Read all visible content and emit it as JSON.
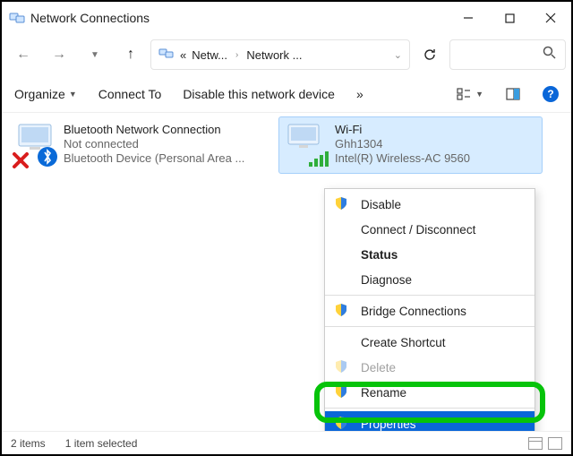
{
  "window": {
    "title": "Network Connections"
  },
  "breadcrumb": {
    "prefix": "«",
    "a": "Netw...",
    "b": "Network ..."
  },
  "toolbar": {
    "organize": "Organize",
    "connect": "Connect To",
    "disable": "Disable this network device",
    "overflow": "»"
  },
  "adapters": {
    "bt": {
      "name": "Bluetooth Network Connection",
      "status": "Not connected",
      "device": "Bluetooth Device (Personal Area ..."
    },
    "wifi": {
      "name": "Wi-Fi",
      "ssid": "Ghh1304",
      "device": "Intel(R) Wireless-AC 9560"
    }
  },
  "context_menu": {
    "disable": "Disable",
    "connect": "Connect / Disconnect",
    "status": "Status",
    "diagnose": "Diagnose",
    "bridge": "Bridge Connections",
    "shortcut": "Create Shortcut",
    "delete": "Delete",
    "rename": "Rename",
    "properties": "Properties"
  },
  "statusbar": {
    "count": "2 items",
    "sel": "1 item selected"
  }
}
